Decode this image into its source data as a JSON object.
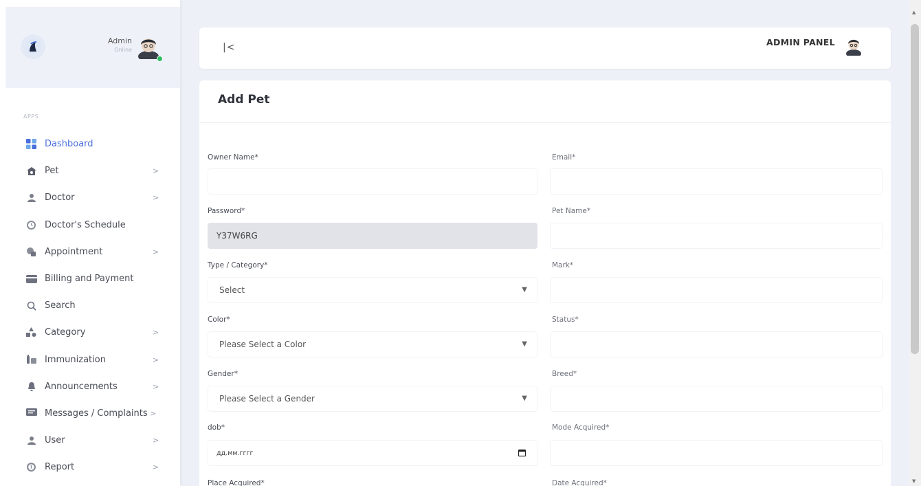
{
  "sidebar": {
    "profile": {
      "name": "Admin",
      "status": "Online"
    },
    "section_label": "APPS",
    "items": [
      {
        "label": "Dashboard",
        "icon": "dashboard-icon",
        "chevron": "",
        "active": true
      },
      {
        "label": "Pet",
        "icon": "pet-icon",
        "chevron": ">"
      },
      {
        "label": "Doctor",
        "icon": "doctor-icon",
        "chevron": ">"
      },
      {
        "label": "Doctor's Schedule",
        "icon": "clock-icon",
        "chevron": ""
      },
      {
        "label": "Appointment",
        "icon": "appointment-icon",
        "chevron": ">"
      },
      {
        "label": "Billing and Payment",
        "icon": "card-icon",
        "chevron": ""
      },
      {
        "label": "Search",
        "icon": "search-icon",
        "chevron": ""
      },
      {
        "label": "Category",
        "icon": "category-icon",
        "chevron": ">"
      },
      {
        "label": "Immunization",
        "icon": "immunization-icon",
        "chevron": ">"
      },
      {
        "label": "Announcements",
        "icon": "bell-icon",
        "chevron": ">"
      },
      {
        "label": "Messages / Complaints",
        "icon": "message-icon",
        "chevron": ">"
      },
      {
        "label": "User",
        "icon": "user-icon",
        "chevron": ">"
      },
      {
        "label": "Report",
        "icon": "report-icon",
        "chevron": ">"
      }
    ]
  },
  "header": {
    "collapse_label": "|<",
    "panel_title": "ADMIN PANEL"
  },
  "form": {
    "title": "Add Pet",
    "fields": {
      "owner_name": {
        "label": "Owner Name*",
        "value": ""
      },
      "email": {
        "label": "Email*",
        "value": ""
      },
      "password": {
        "label": "Password*",
        "value": "Y37W6RG"
      },
      "pet_name": {
        "label": "Pet Name*",
        "value": ""
      },
      "type_category": {
        "label": "Type / Category*",
        "value": "Select"
      },
      "mark": {
        "label": "Mark*",
        "value": ""
      },
      "color": {
        "label": "Color*",
        "value": "Please Select a Color"
      },
      "status": {
        "label": "Status*",
        "value": ""
      },
      "gender": {
        "label": "Gender*",
        "value": "Please Select a Gender"
      },
      "breed": {
        "label": "Breed*",
        "value": ""
      },
      "dob": {
        "label": "dob*",
        "value": "дд.мм.гггг"
      },
      "mode_acquired": {
        "label": "Mode Acquired*",
        "value": ""
      },
      "place_acquired": {
        "label": "Place Acquired*",
        "value": ""
      },
      "date_acquired": {
        "label": "Date Acquired*",
        "value": ""
      }
    }
  },
  "colors": {
    "accent": "#4a6fdc",
    "online": "#2fbd63",
    "background": "#edf0f7"
  }
}
